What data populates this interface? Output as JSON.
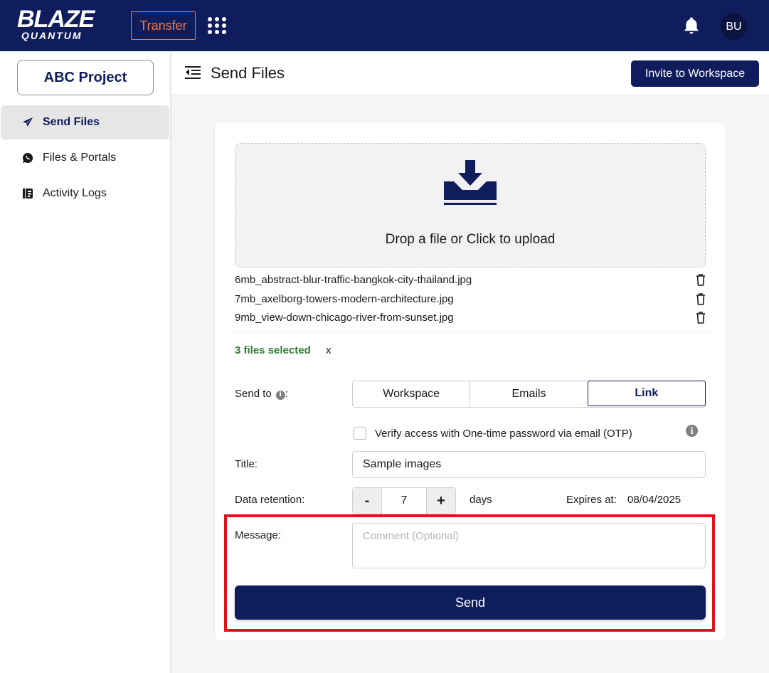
{
  "topbar": {
    "logo_main": "BLAZE",
    "logo_sub": "QUANTUM",
    "transfer_label": "Transfer",
    "avatar_initials": "BU",
    "icons": [
      "apps-grid-icon",
      "bell-icon"
    ],
    "brand_color": "#0f1d5c",
    "accent_color": "#f07a4a"
  },
  "sidebar": {
    "project_label": "ABC Project",
    "items": [
      {
        "label": "Send Files",
        "icon": "paper-plane-icon",
        "active": true
      },
      {
        "label": "Files & Portals",
        "icon": "chat-bubble-icon",
        "active": false
      },
      {
        "label": "Activity Logs",
        "icon": "log-book-icon",
        "active": false
      }
    ]
  },
  "header": {
    "title": "Send Files",
    "invite_label": "Invite to Workspace"
  },
  "upload": {
    "drop_text": "Drop a file or Click to upload",
    "files": [
      "6mb_abstract-blur-traffic-bangkok-city-thailand.jpg",
      "7mb_axelborg-towers-modern-architecture.jpg",
      "9mb_view-down-chicago-river-from-sunset.jpg"
    ],
    "selected_count": "3 files selected",
    "clear_label": "x"
  },
  "form": {
    "send_to_label": "Send to",
    "send_to_colon": ":",
    "send_to_options": [
      "Workspace",
      "Emails",
      "Link"
    ],
    "send_to_selected": "Link",
    "otp_label": "Verify access with One-time password via email (OTP)",
    "otp_checked": false,
    "title_label": "Title:",
    "title_value": "Sample images",
    "retention_label": "Data retention:",
    "retention_minus": "-",
    "retention_value": "7",
    "retention_plus": "+",
    "retention_unit": "days",
    "expires_label": "Expires at:",
    "expires_value": "08/04/2025",
    "message_label": "Message:",
    "message_placeholder": "Comment (Optional)",
    "send_label": "Send"
  },
  "highlight_color": "#e0131a"
}
